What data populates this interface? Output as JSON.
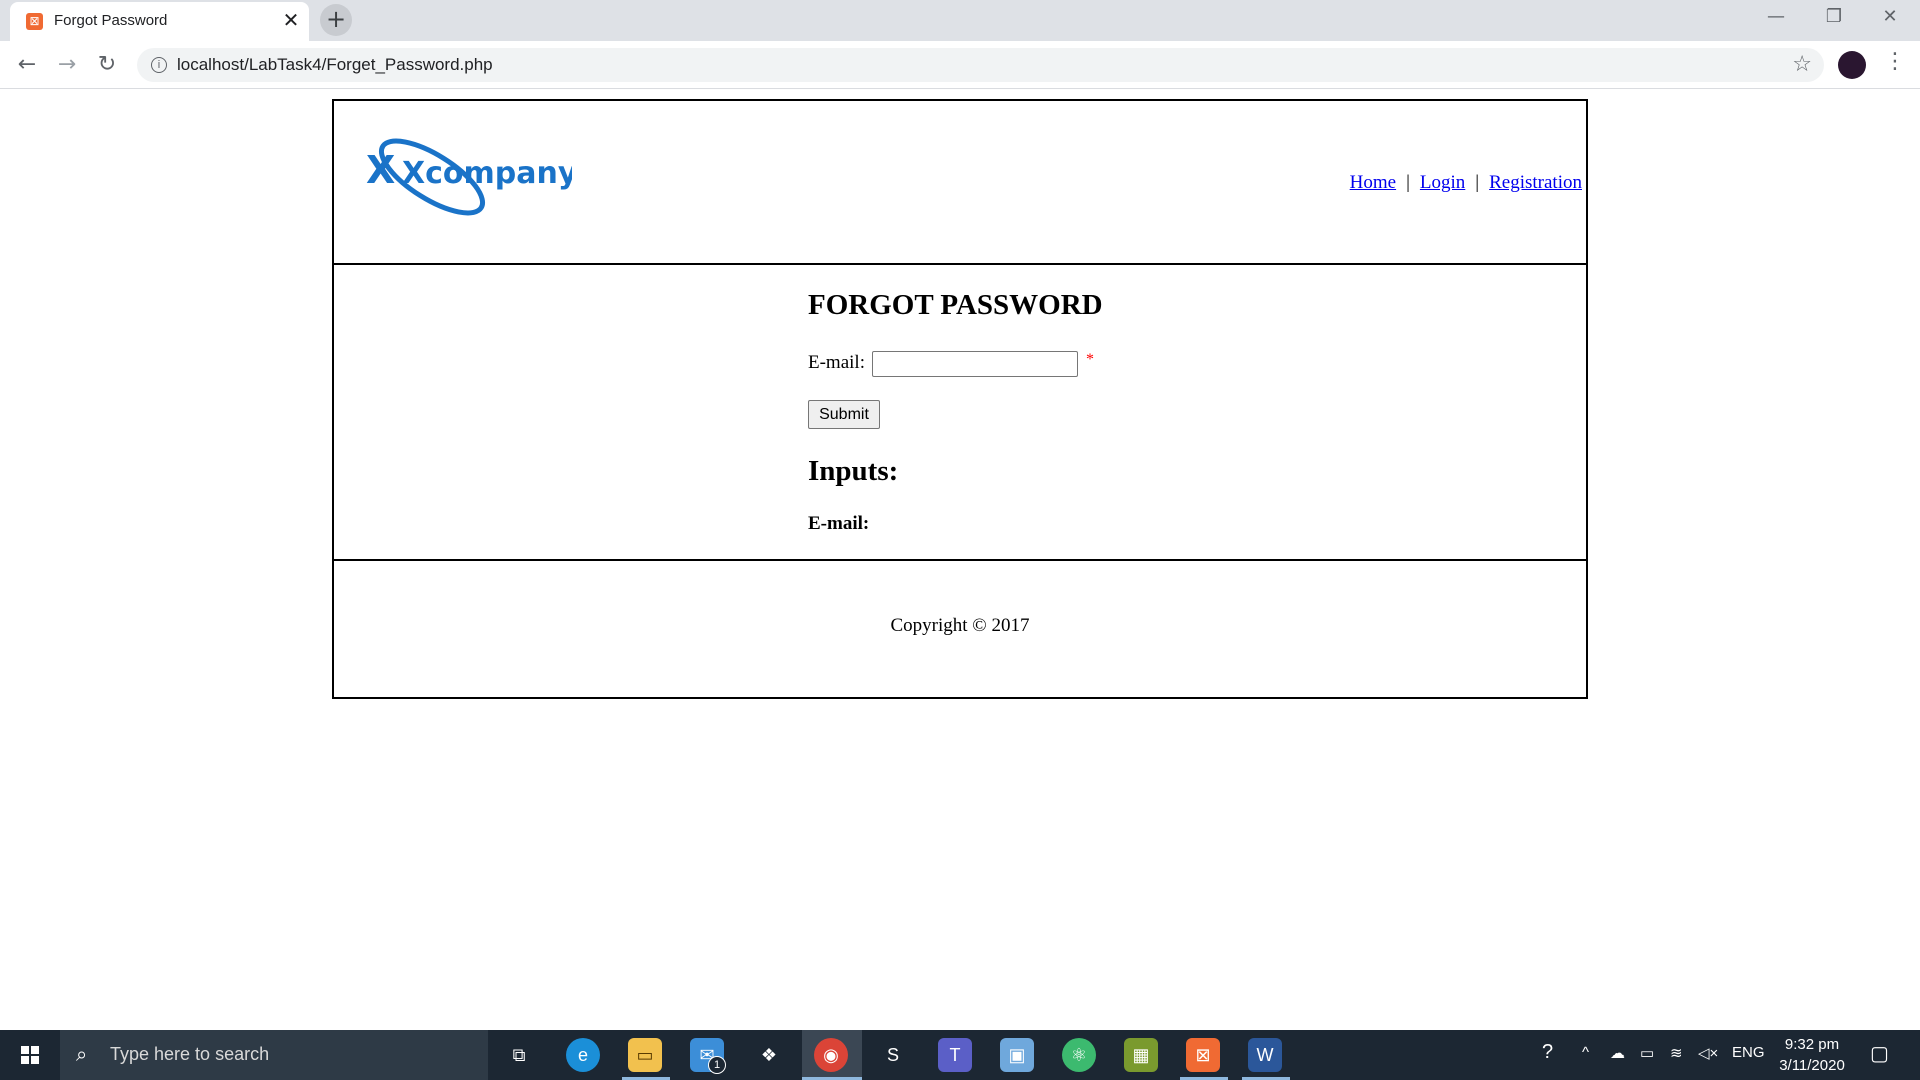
{
  "browser": {
    "tab_title": "Forgot Password",
    "tab_close": "✕",
    "new_tab": "+",
    "url": "localhost/LabTask4/Forget_Password.php"
  },
  "header": {
    "logo_text": "Xcompany",
    "nav": [
      {
        "label": "Home"
      },
      {
        "label": "Login"
      },
      {
        "label": "Registration"
      }
    ],
    "separator": "|"
  },
  "form": {
    "title": "FORGOT PASSWORD",
    "email_label": "E-mail:",
    "email_value": "",
    "required_mark": "*",
    "submit_label": "Submit",
    "inputs_title": "Inputs:",
    "inputs_email_label": "E-mail:"
  },
  "footer": {
    "copyright": "Copyright © 2017"
  },
  "taskbar": {
    "search_placeholder": "Type here to search",
    "mail_badge": "1",
    "language": "ENG",
    "time": "9:32 pm",
    "date": "3/11/2020"
  },
  "colors": {
    "link": "#0000ee",
    "required": "#ff0000",
    "logo_blue": "#1a73c8"
  }
}
